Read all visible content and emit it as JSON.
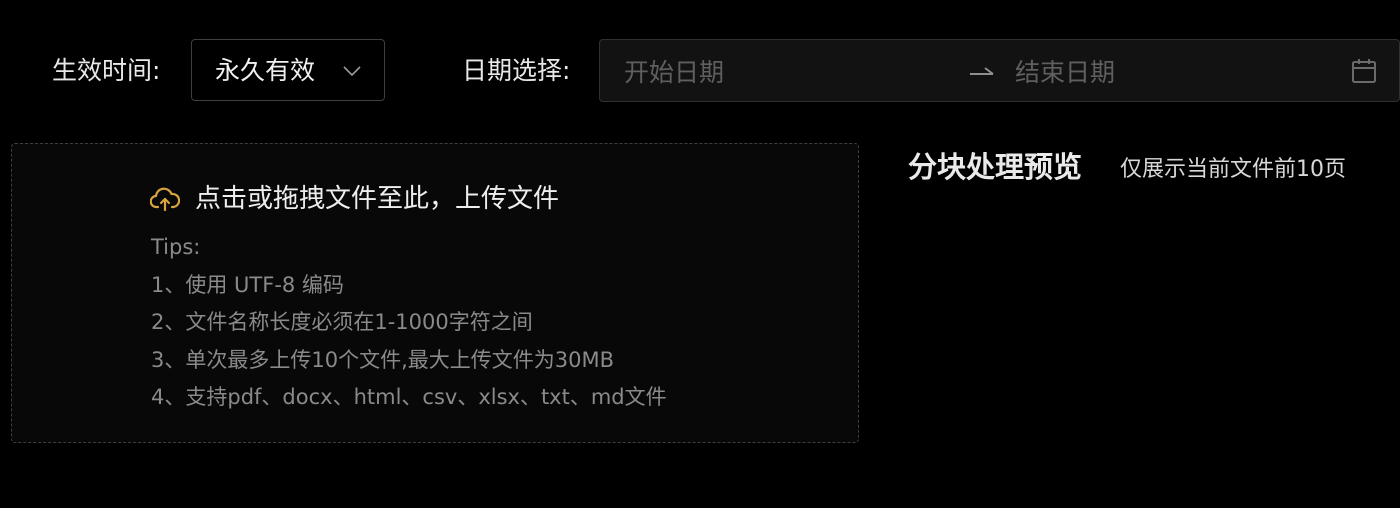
{
  "filters": {
    "effective_time_label": "生效时间:",
    "effective_time_value": "永久有效",
    "date_select_label": "日期选择:",
    "start_date_placeholder": "开始日期",
    "end_date_placeholder": "结束日期"
  },
  "upload": {
    "title": "点击或拖拽文件至此，上传文件",
    "tips": [
      "Tips:",
      "1、使用 UTF-8 编码",
      "2、文件名称长度必须在1-1000字符之间",
      "3、单次最多上传10个文件,最大上传文件为30MB",
      "4、支持pdf、docx、html、csv、xlsx、txt、md文件"
    ]
  },
  "preview": {
    "title": "分块处理预览",
    "subtitle": "仅展示当前文件前10页"
  },
  "icons": {
    "select_arrow": "chevron-down-icon",
    "range_separator": "arrow-right-icon",
    "calendar": "calendar-icon",
    "upload": "cloud-upload-icon"
  },
  "colors": {
    "accent": "#d9a441",
    "background": "#000000",
    "muted_text": "#8a8a8a"
  }
}
